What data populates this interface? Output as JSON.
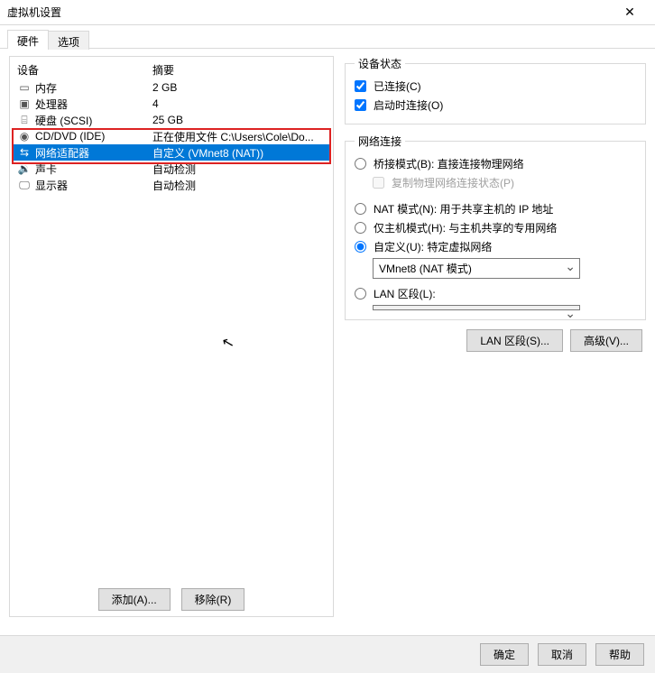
{
  "window": {
    "title": "虚拟机设置"
  },
  "tabs": {
    "hardware": "硬件",
    "options": "选项"
  },
  "columns": {
    "device": "设备",
    "summary": "摘要"
  },
  "devices": [
    {
      "name": "内存",
      "summary": "2 GB"
    },
    {
      "name": "处理器",
      "summary": "4"
    },
    {
      "name": "硬盘 (SCSI)",
      "summary": "25 GB"
    },
    {
      "name": "CD/DVD (IDE)",
      "summary": "正在使用文件 C:\\Users\\Cole\\Do..."
    },
    {
      "name": "网络适配器",
      "summary": "自定义 (VMnet8 (NAT))"
    },
    {
      "name": "声卡",
      "summary": "自动检测"
    },
    {
      "name": "显示器",
      "summary": "自动检测"
    }
  ],
  "left_buttons": {
    "add": "添加(A)...",
    "remove": "移除(R)"
  },
  "device_status": {
    "legend": "设备状态",
    "connected": "已连接(C)",
    "connect_at_power_on": "启动时连接(O)"
  },
  "net": {
    "legend": "网络连接",
    "bridged": "桥接模式(B): 直接连接物理网络",
    "replicate": "复制物理网络连接状态(P)",
    "nat": "NAT 模式(N): 用于共享主机的 IP 地址",
    "hostonly": "仅主机模式(H): 与主机共享的专用网络",
    "custom": "自定义(U): 特定虚拟网络",
    "custom_value": "VMnet8 (NAT 模式)",
    "lan_segment": "LAN 区段(L):",
    "lan_value": ""
  },
  "right_buttons": {
    "lan": "LAN 区段(S)...",
    "advanced": "高级(V)..."
  },
  "footer": {
    "ok": "确定",
    "cancel": "取消",
    "help": "帮助"
  }
}
